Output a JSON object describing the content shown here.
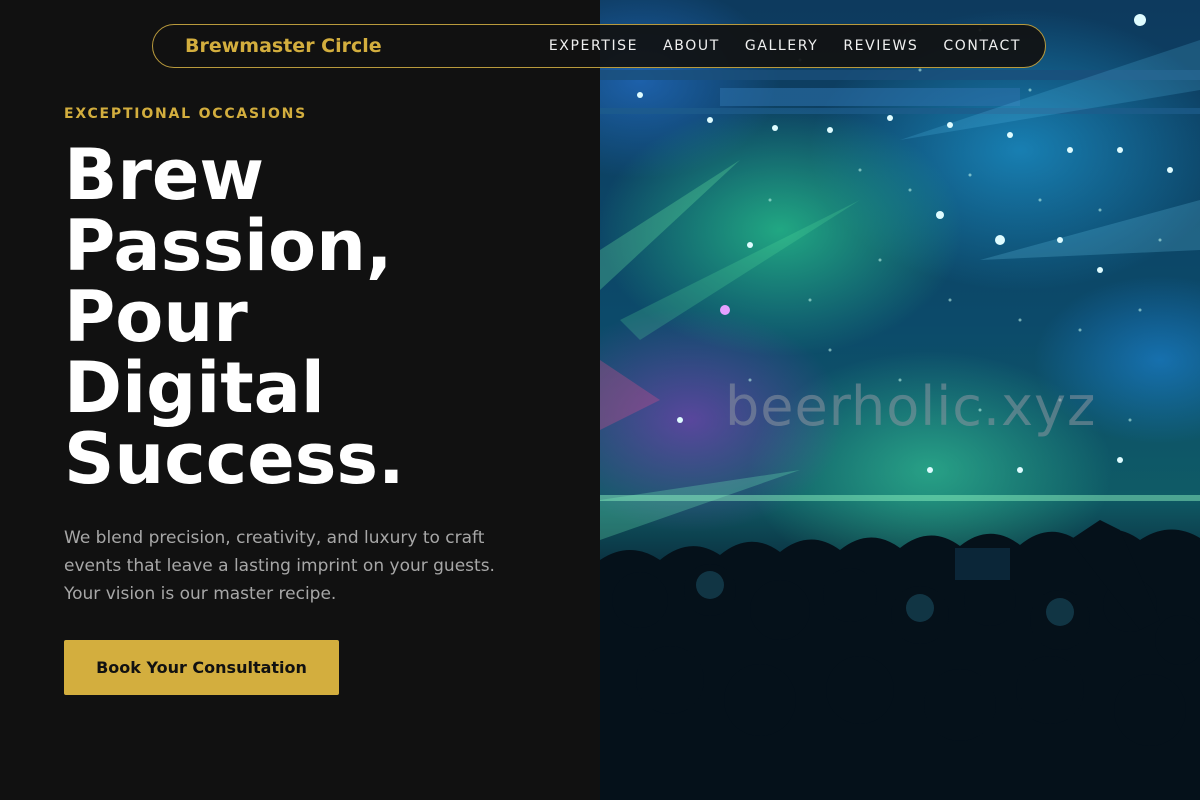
{
  "nav": {
    "brand": "Brewmaster Circle",
    "links": [
      "EXPERTISE",
      "ABOUT",
      "GALLERY",
      "REVIEWS",
      "CONTACT"
    ]
  },
  "hero": {
    "eyebrow": "EXCEPTIONAL OCCASIONS",
    "headline_lines": [
      "Brew",
      "Passion,",
      "Pour",
      "Digital",
      "Success."
    ],
    "description_lines": [
      "We blend precision, creativity, and luxury to craft",
      "events that leave a lasting imprint on your guests.",
      "Your vision is our master recipe."
    ],
    "cta_label": "Book Your Consultation"
  },
  "image": {
    "watermark": "beerholic.xyz"
  },
  "colors": {
    "accent": "#d3ae3e",
    "background": "#111111",
    "text_muted": "#a7a7a7"
  }
}
